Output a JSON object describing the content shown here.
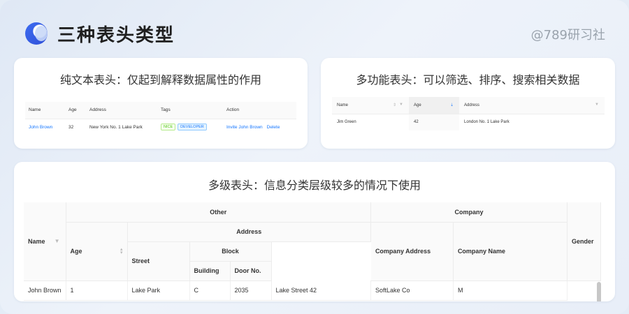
{
  "header": {
    "title": "三种表头类型",
    "watermark": "@789研习社"
  },
  "card1": {
    "title": "纯文本表头：仅起到解释数据属性的作用",
    "columns": [
      "Name",
      "Age",
      "Address",
      "Tags",
      "Action"
    ],
    "row": {
      "name": "John Brown",
      "age": "32",
      "address": "New York No. 1 Lake Park",
      "tags": [
        "NICE",
        "DEVELOPER"
      ],
      "actions": [
        "Invite John Brown",
        "Delete"
      ]
    }
  },
  "card2": {
    "title": "多功能表头：可以筛选、排序、搜索相关数据",
    "columns": [
      "Name",
      "Age",
      "Address"
    ],
    "row": {
      "name": "Jim Green",
      "age": "42",
      "address": "London No. 1 Lake Park"
    }
  },
  "card3": {
    "title": "多级表头：信息分类层级较多的情况下使用",
    "headers": {
      "name": "Name",
      "other": "Other",
      "company": "Company",
      "gender": "Gender",
      "age": "Age",
      "address": "Address",
      "street": "Street",
      "block": "Block",
      "building": "Building",
      "door": "Door No.",
      "company_address": "Company Address",
      "company_name": "Company Name"
    },
    "row": {
      "name": "John Brown",
      "age": "1",
      "street": "Lake Park",
      "building": "C",
      "door": "2035",
      "company_address": "Lake Street 42",
      "company_name": "SoftLake Co",
      "gender": "M"
    }
  },
  "colors": {
    "link": "#1677ff",
    "accent": "#3d6cf0",
    "nice_tag": "#52c41a"
  },
  "icons": [
    "logo-icon",
    "filter-icon",
    "sort-icon",
    "search-icon"
  ]
}
